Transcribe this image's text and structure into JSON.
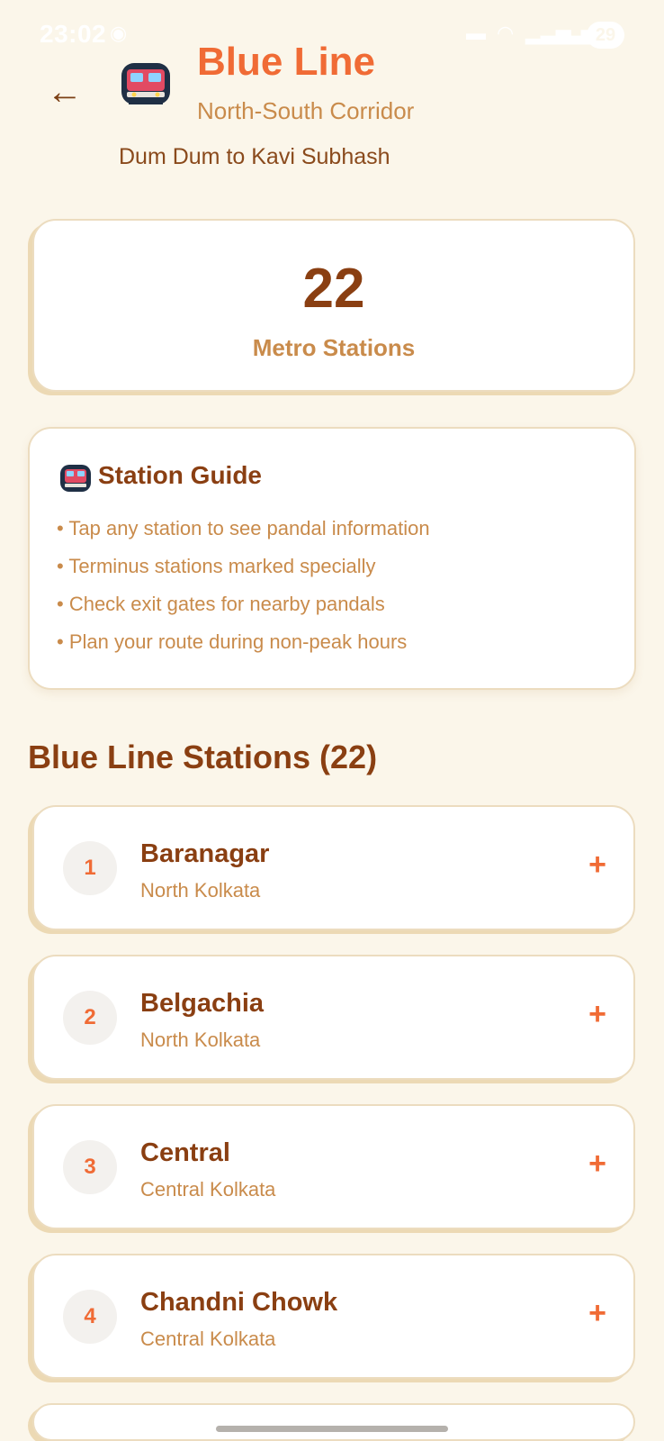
{
  "status_bar": {
    "time": "23:02",
    "battery": "29"
  },
  "header": {
    "title": "Blue Line",
    "subtitle": "North-South Corridor",
    "route": "Dum Dum to Kavi Subhash",
    "back_icon": "arrow-left-icon",
    "line_icon": "metro-train-icon"
  },
  "stats": {
    "count": "22",
    "label": "Metro Stations"
  },
  "guide": {
    "title": "Station Guide",
    "items": [
      "• Tap any station to see pandal information",
      "• Terminus stations marked specially",
      "• Check exit gates for nearby pandals",
      "• Plan your route during non-peak hours"
    ]
  },
  "stations_section": {
    "title": "Blue Line Stations (22)",
    "expand_icon": "plus-icon",
    "stations": [
      {
        "number": "1",
        "name": "Baranagar",
        "area": "North Kolkata"
      },
      {
        "number": "2",
        "name": "Belgachia",
        "area": "North Kolkata"
      },
      {
        "number": "3",
        "name": "Central",
        "area": "Central Kolkata"
      },
      {
        "number": "4",
        "name": "Chandni Chowk",
        "area": "Central Kolkata"
      }
    ]
  },
  "colors": {
    "background": "#fbf6ea",
    "accent": "#f06b35",
    "title_brown": "#8a3f12",
    "muted_tan": "#c98b4b"
  }
}
